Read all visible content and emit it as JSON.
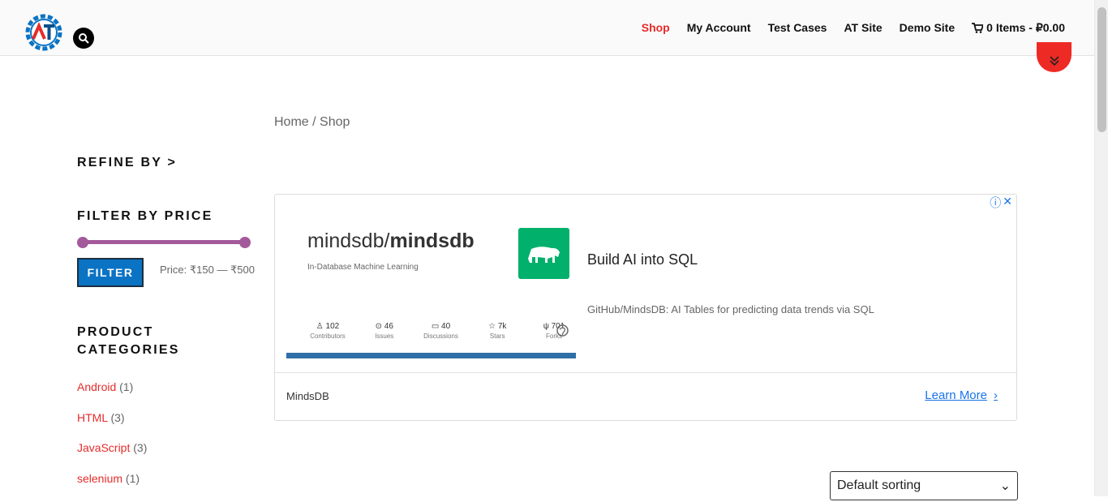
{
  "header": {
    "nav": [
      "Shop",
      "My Account",
      "Test Cases",
      "AT Site",
      "Demo Site"
    ],
    "active": "Shop",
    "cart": "0 Items - ₽0.00"
  },
  "breadcrumb": "Home / Shop",
  "sidebar": {
    "refine": "REFINE BY >",
    "filter_price": "FILTER BY PRICE",
    "filter_button": "FILTER",
    "price_label": "Price: ₹150 — ₹500",
    "product_categories": [
      "PRODUCT",
      "CATEGORIES"
    ],
    "categories": [
      {
        "name": "Android",
        "count": "(1)"
      },
      {
        "name": "HTML",
        "count": "(3)"
      },
      {
        "name": "JavaScript",
        "count": "(3)"
      },
      {
        "name": "selenium",
        "count": "(1)"
      }
    ]
  },
  "ad": {
    "repo_owner": "mindsdb/",
    "repo_name": "mindsdb",
    "small_desc": "In-Database Machine Learning",
    "stats": [
      {
        "number": "102",
        "label": "Contributors",
        "icon": "contributors-icon"
      },
      {
        "number": "46",
        "label": "Issues",
        "icon": "issues-icon"
      },
      {
        "number": "40",
        "label": "Discussions",
        "icon": "discussions-icon"
      },
      {
        "number": "7k",
        "label": "Stars",
        "icon": "star-icon"
      },
      {
        "number": "701",
        "label": "Forks",
        "icon": "fork-icon"
      }
    ],
    "headline": "Build AI into SQL",
    "subtext": "GitHub/MindsDB: AI Tables for predicting data trends via SQL",
    "advertiser": "MindsDB",
    "cta": "Learn More"
  },
  "sort": "Default sorting",
  "colors": {
    "accent_red": "#e62b2b",
    "filter_blue": "#0b73c3",
    "slider_purple": "#a35a9b",
    "ad_green": "#00b06b",
    "link_blue": "#1a73e8"
  }
}
